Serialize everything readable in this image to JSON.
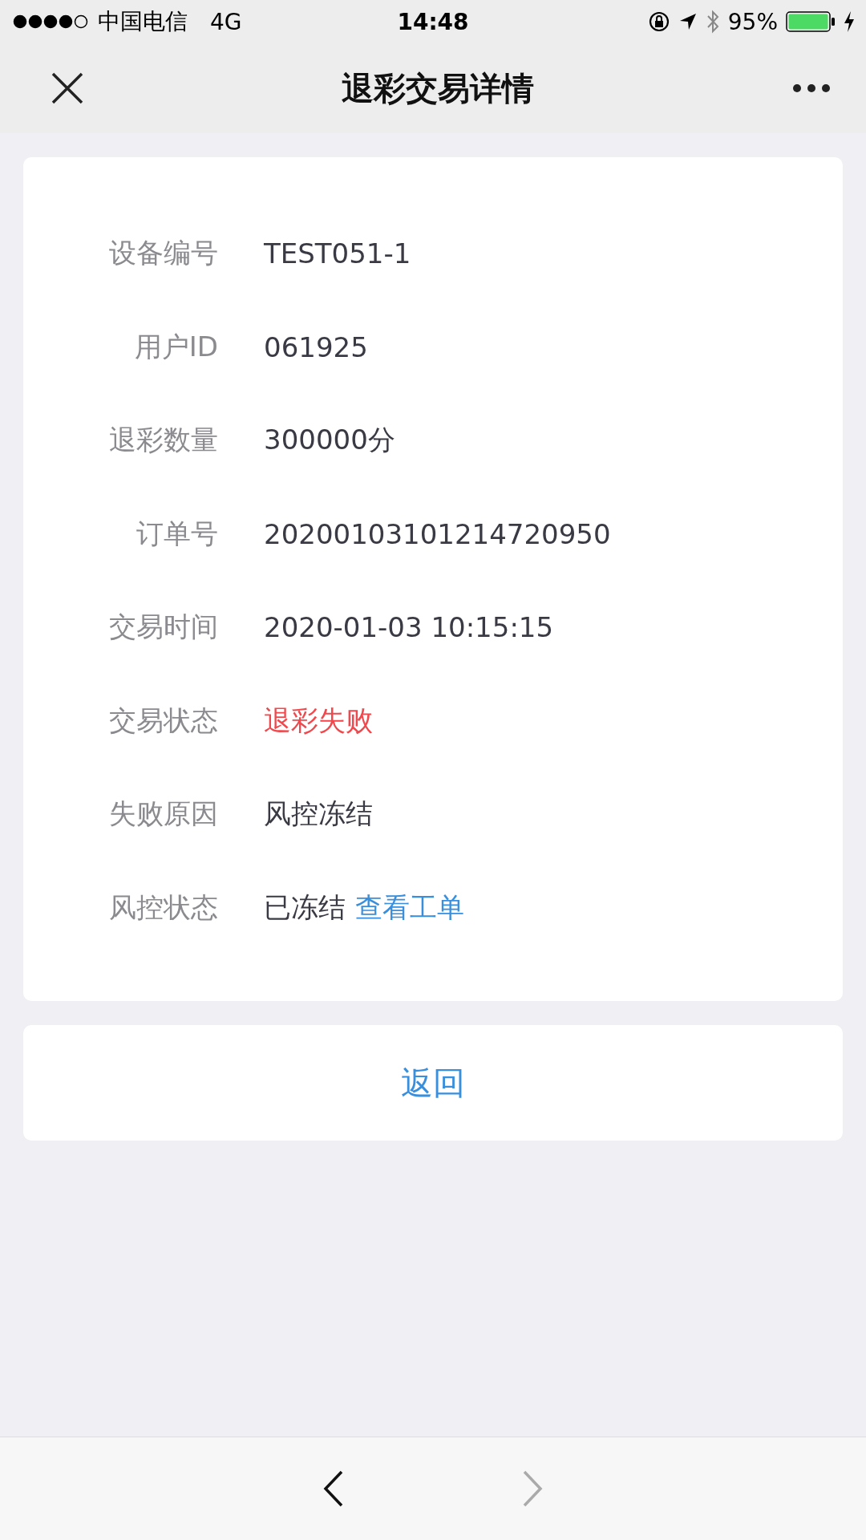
{
  "status_bar": {
    "carrier": "中国电信",
    "network": "4G",
    "time": "14:48",
    "battery": "95%"
  },
  "nav": {
    "title": "退彩交易详情"
  },
  "details": [
    {
      "label": "设备编号",
      "value": "TEST051-1",
      "kind": "text"
    },
    {
      "label": "用户ID",
      "value": "061925",
      "kind": "text"
    },
    {
      "label": "退彩数量",
      "value": "300000分",
      "kind": "text"
    },
    {
      "label": "订单号",
      "value": "20200103101214720950",
      "kind": "text"
    },
    {
      "label": "交易时间",
      "value": "2020-01-03 10:15:15",
      "kind": "text"
    },
    {
      "label": "交易状态",
      "value": "退彩失败",
      "kind": "alert"
    },
    {
      "label": "失败原因",
      "value": "风控冻结",
      "kind": "text"
    },
    {
      "label": "风控状态",
      "value": "已冻结",
      "kind": "link",
      "link": "查看工单"
    }
  ],
  "return_button": "返回",
  "toolbar": {
    "back_disabled": false,
    "forward_disabled": true
  }
}
